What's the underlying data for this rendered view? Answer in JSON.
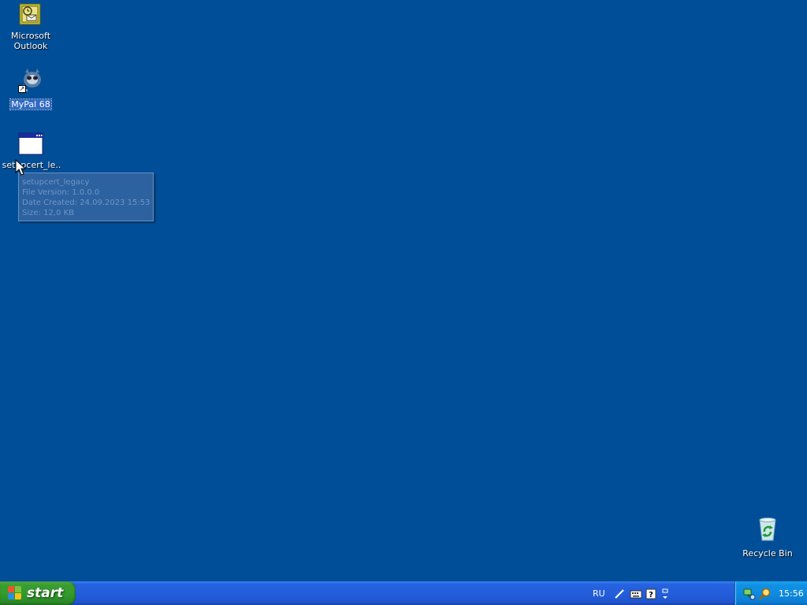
{
  "desktop": {
    "icons": [
      {
        "label": "Microsoft Outlook",
        "icon": "outlook-icon"
      },
      {
        "label": "MyPal 68",
        "icon": "mypal-icon"
      },
      {
        "label": "setupcert_le...",
        "icon": "application-window-icon"
      },
      {
        "label": "Recycle Bin",
        "icon": "recycle-bin-icon"
      }
    ],
    "background_color": "#004e98"
  },
  "tooltip": {
    "name": "setupcert_legacy",
    "file_version": "File Version: 1.0.0.0",
    "date_created": "Date Created: 24.09.2023 15:53",
    "size": "Size: 12,0 KB"
  },
  "taskbar": {
    "start_label": "start",
    "language": "RU",
    "clock": "15:56",
    "tray_icons": [
      "network-icon",
      "search-icon"
    ],
    "quick_icons": [
      "pen-icon",
      "keyboard-icon",
      "help-icon",
      "options-arrow-icon"
    ]
  }
}
